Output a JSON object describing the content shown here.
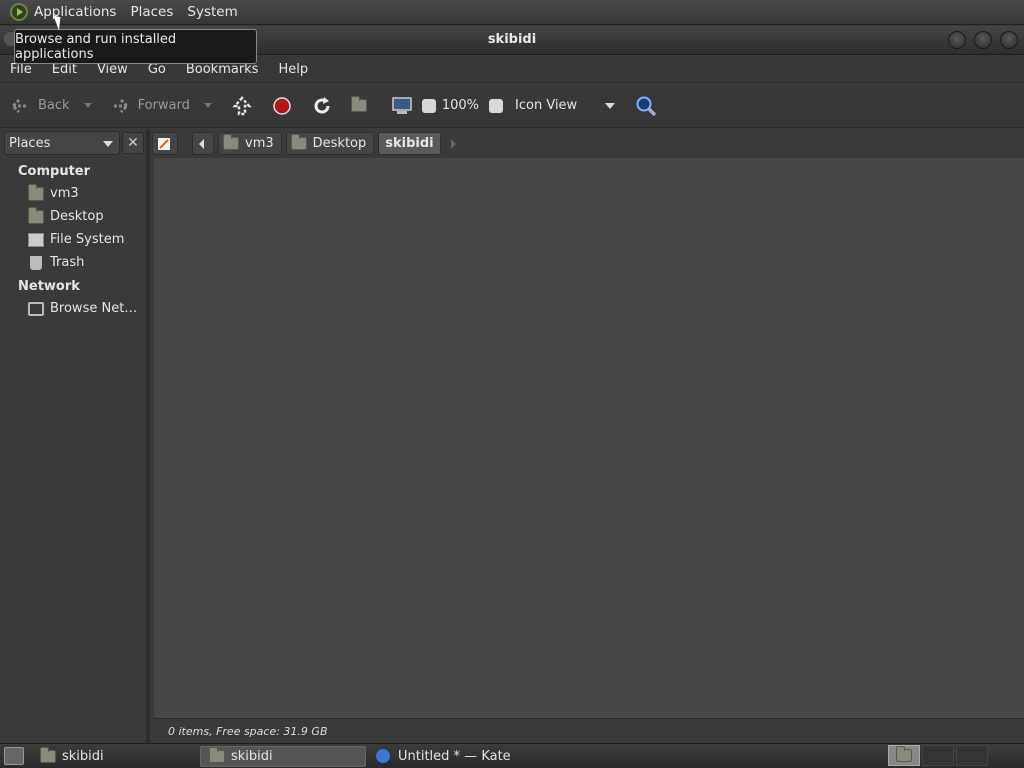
{
  "topbar": {
    "menus": [
      "Applications",
      "Places",
      "System"
    ]
  },
  "tooltip": "Browse and run installed applications",
  "window": {
    "title": "skibidi",
    "menubar": [
      "File",
      "Edit",
      "View",
      "Go",
      "Bookmarks",
      "Help"
    ]
  },
  "toolbar": {
    "back_label": "Back",
    "forward_label": "Forward",
    "zoom": "100%",
    "view_mode": "Icon View"
  },
  "pathbar": {
    "crumbs": [
      "vm3",
      "Desktop",
      "skibidi"
    ]
  },
  "sidebar": {
    "selector": "Places",
    "sections": [
      {
        "title": "Computer",
        "items": [
          "vm3",
          "Desktop",
          "File System",
          "Trash"
        ]
      },
      {
        "title": "Network",
        "items": [
          "Browse Net…"
        ]
      }
    ]
  },
  "status": "0 items, Free space: 31.9 GB",
  "taskbar": {
    "tasks": [
      "skibidi",
      "skibidi",
      "Untitled * — Kate"
    ],
    "active_index": 1
  }
}
